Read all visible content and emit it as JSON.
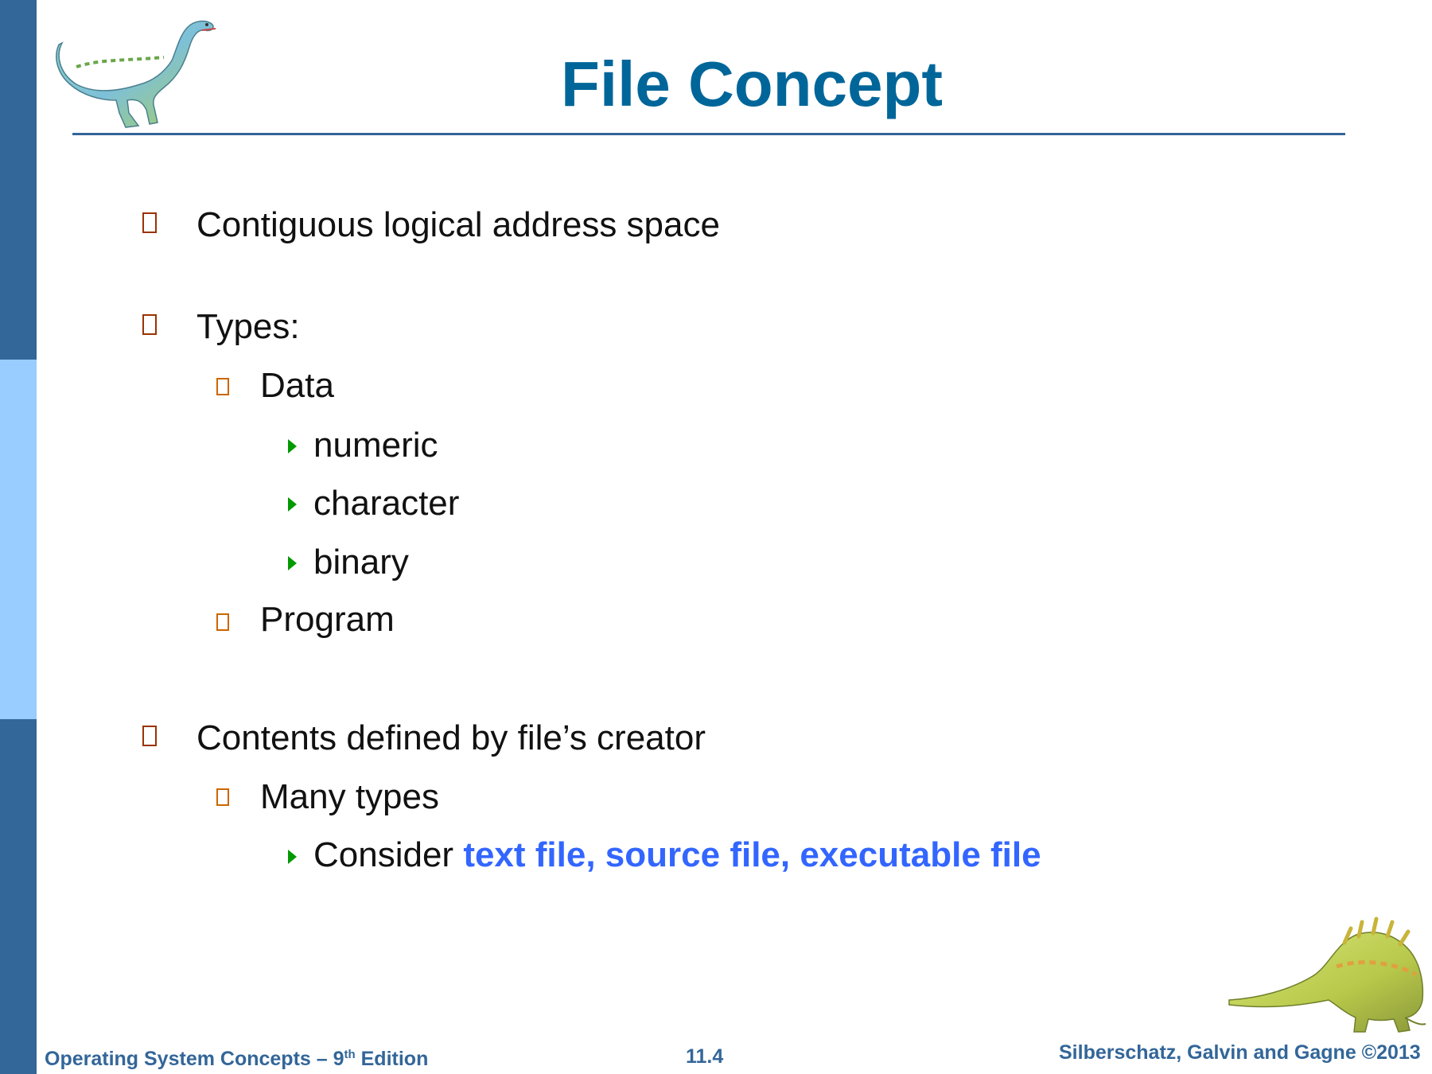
{
  "slide": {
    "title": "File Concept",
    "bullets": [
      {
        "level": 1,
        "text": "Contiguous logical address space"
      },
      {
        "level": 1,
        "text": "Types:"
      },
      {
        "level": 2,
        "text": "Data"
      },
      {
        "level": 3,
        "text": "numeric"
      },
      {
        "level": 3,
        "text": "character"
      },
      {
        "level": 3,
        "text": "binary"
      },
      {
        "level": 2,
        "text": "Program"
      },
      {
        "level": 1,
        "text": "Contents defined by file’s creator"
      },
      {
        "level": 2,
        "text": "Many types"
      },
      {
        "level": 3,
        "text": "Consider ",
        "highlight": "text file, source file, executable file"
      }
    ]
  },
  "footer": {
    "book_prefix": "Operating System  Concepts  – 9",
    "book_sup": "th",
    "book_suffix": " Edition",
    "page_number": "11.4",
    "copyright": "Silberschatz, Galvin and Gagne ©2013"
  },
  "colors": {
    "title": "#006699",
    "accent_bar_dark": "#336699",
    "accent_bar_light": "#99ccff",
    "highlight": "#3366ff",
    "box_marker": "#993300",
    "triangle_marker": "#009900"
  },
  "icons": {
    "top_logo": "dinosaur-logo-icon",
    "bottom_logo": "dinosaur-logo-icon",
    "level1_marker": "square-bullet-icon",
    "level2_marker": "square-bullet-icon",
    "level3_marker": "triangle-bullet-icon"
  }
}
